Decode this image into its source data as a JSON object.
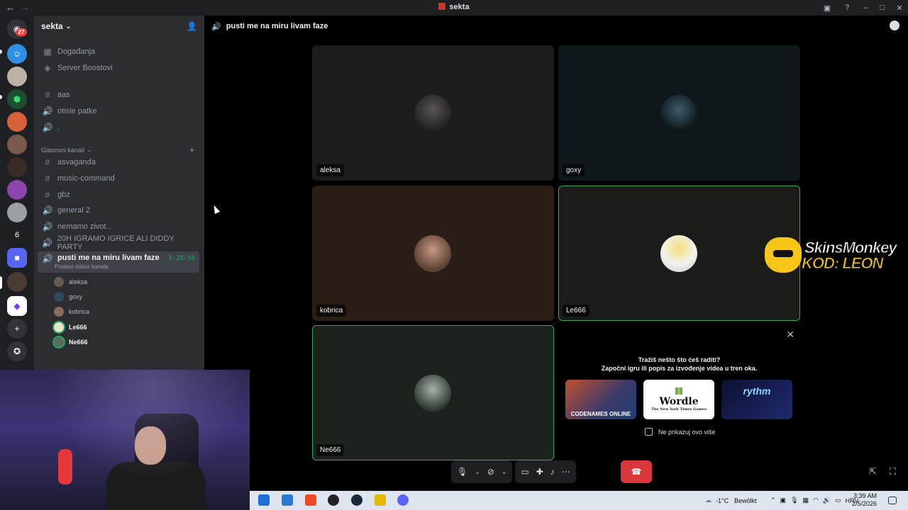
{
  "window": {
    "title": "sekta"
  },
  "rail": {
    "dm_badge": "27",
    "folder_number": "6"
  },
  "sidebar": {
    "server_name": "sekta",
    "top_items": [
      {
        "label": "Događanja",
        "icon": "calendar-icon"
      },
      {
        "label": "Server Boostovi",
        "icon": "boost-icon"
      }
    ],
    "channels_a": [
      {
        "label": "aas",
        "type": "text"
      },
      {
        "label": "otisle patke",
        "type": "voice"
      },
      {
        "label": ".",
        "type": "voice"
      }
    ],
    "category": {
      "label": "Glasovni kanali"
    },
    "channels_b": [
      {
        "label": "asvaganda",
        "type": "text"
      },
      {
        "label": "music-command",
        "type": "text"
      },
      {
        "label": "gbz",
        "type": "text"
      },
      {
        "label": "general 2",
        "type": "voice"
      },
      {
        "label": "nemamo zivot...",
        "type": "voice"
      },
      {
        "label": "20H IGRAMO IGRICE ALI DIDDY PARTY",
        "type": "voice"
      }
    ],
    "active_channel": {
      "label": "pusti me na miru livam faze",
      "time": "3:28:50",
      "status": "Postavi status kanala"
    },
    "voice_users": [
      {
        "name": "aleksa",
        "speaking": false
      },
      {
        "name": "goxy",
        "speaking": false
      },
      {
        "name": "kobrica",
        "speaking": false
      },
      {
        "name": "Le666",
        "speaking": true
      },
      {
        "name": "Ne666",
        "speaking": true
      }
    ]
  },
  "voice": {
    "header": "pusti me na miru livam faze",
    "tiles": [
      {
        "name": "aleksa",
        "bg": "#1c1c1c",
        "speaking": false
      },
      {
        "name": "goxy",
        "bg": "#0f171b",
        "speaking": false
      },
      {
        "name": "kobrica",
        "bg": "#2a1d16",
        "speaking": false
      },
      {
        "name": "Le666",
        "bg": "#1b1c1a",
        "speaking": true
      },
      {
        "name": "Ne666",
        "bg": "#1c231d",
        "speaking": true
      }
    ],
    "activity": {
      "line1": "Tražiš nešto što ćeš raditi?",
      "line2": "Započni igru ili popis za izvođenje videa u tren oka.",
      "games": [
        "CODENAMES ONLINE",
        "Wordle",
        "rythm"
      ],
      "wordle_sub": "The New York Times Games",
      "hide_label": "Ne prikazuj ovo više"
    }
  },
  "sponsor": {
    "line1": "SkinsMonkey",
    "line2": "KOD: LEON"
  },
  "taskbar": {
    "weather_temp": "-1°C",
    "weather_text": "Bewölkt",
    "lang": "HRV",
    "time": "3:39 AM",
    "date": "2/5/2026"
  }
}
